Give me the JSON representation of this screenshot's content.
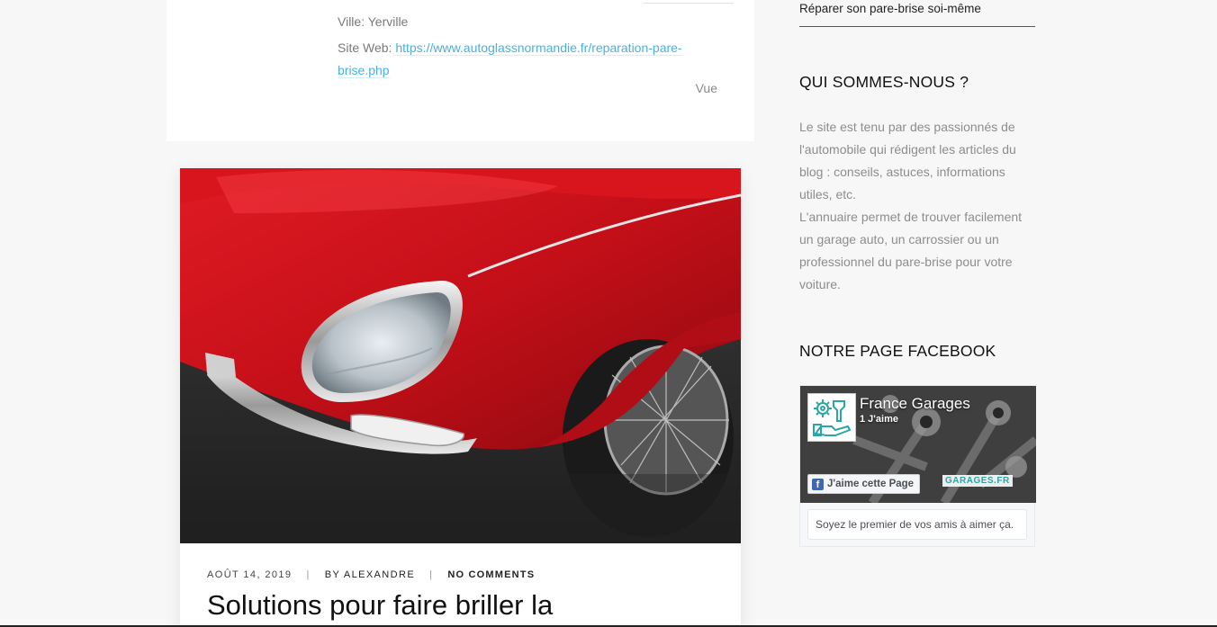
{
  "prev_article": {
    "city_label": "Ville: Yerville",
    "site_label": "Site Web: ",
    "site_url": "https://www.autoglassnormandie.fr/reparation-pare-brise.php",
    "vue_label": "Vue"
  },
  "article": {
    "image_alt": "Red Jaguar E-Type front headlight",
    "date": "AOÛT 14, 2019",
    "author": "BY ALEXANDRE",
    "comments": "NO COMMENTS",
    "title": "Solutions pour faire briller la"
  },
  "sidebar": {
    "recent_link": "Réparer son pare-brise soi-même",
    "about_title": "QUI SOMMES-NOUS ?",
    "about_p1": "Le site est tenu par des passionnés de l'automobile qui rédigent les articles du blog : conseils, astuces, informations utiles, etc.",
    "about_p2": "L'annuaire permet de trouver facilement un garage auto, un carrossier ou un professionnel du pare-brise pour votre voiture.",
    "facebook_title": "NOTRE PAGE FACEBOOK",
    "facebook": {
      "page_name": "France Garages",
      "likes": "1 J'aime",
      "like_button": "J'aime cette Page",
      "brand_text": "GARAGES.FR",
      "friends_text": "Soyez le premier de vos amis à aimer ça."
    }
  },
  "colors": {
    "link": "#4ab0e0",
    "car_red": "#c8101b",
    "facebook_blue": "#4267b2",
    "teal_logo": "#2aa6a6"
  }
}
